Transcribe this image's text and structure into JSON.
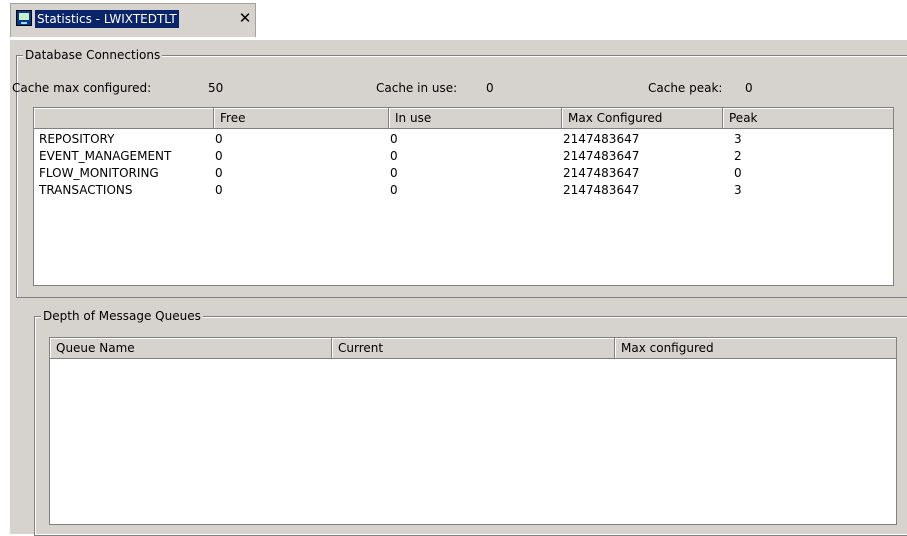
{
  "tab": {
    "title": "Statistics - LWIXTEDTLT",
    "close_symbol": "✕",
    "icon": "monitor-app-icon"
  },
  "db": {
    "legend": "Database Connections",
    "cache_max_label": "Cache max configured:",
    "cache_max_value": "50",
    "cache_in_use_label": "Cache in use:",
    "cache_in_use_value": "0",
    "cache_peak_label": "Cache peak:",
    "cache_peak_value": "0",
    "columns": [
      "",
      "Free",
      "In use",
      "Max Configured",
      "Peak"
    ],
    "rows": [
      {
        "name": "REPOSITORY",
        "free": "0",
        "in_use": "0",
        "max": "2147483647",
        "peak": "3"
      },
      {
        "name": "EVENT_MANAGEMENT",
        "free": "0",
        "in_use": "0",
        "max": "2147483647",
        "peak": "2"
      },
      {
        "name": "FLOW_MONITORING",
        "free": "0",
        "in_use": "0",
        "max": "2147483647",
        "peak": "0"
      },
      {
        "name": "TRANSACTIONS",
        "free": "0",
        "in_use": "0",
        "max": "2147483647",
        "peak": "3"
      }
    ]
  },
  "queues": {
    "legend": "Depth of Message Queues",
    "columns": [
      "Queue Name",
      "Current",
      "Max configured"
    ],
    "rows": []
  },
  "colors": {
    "panel": "#d6d3ce",
    "selection": "#0a246a",
    "border": "#808080"
  }
}
